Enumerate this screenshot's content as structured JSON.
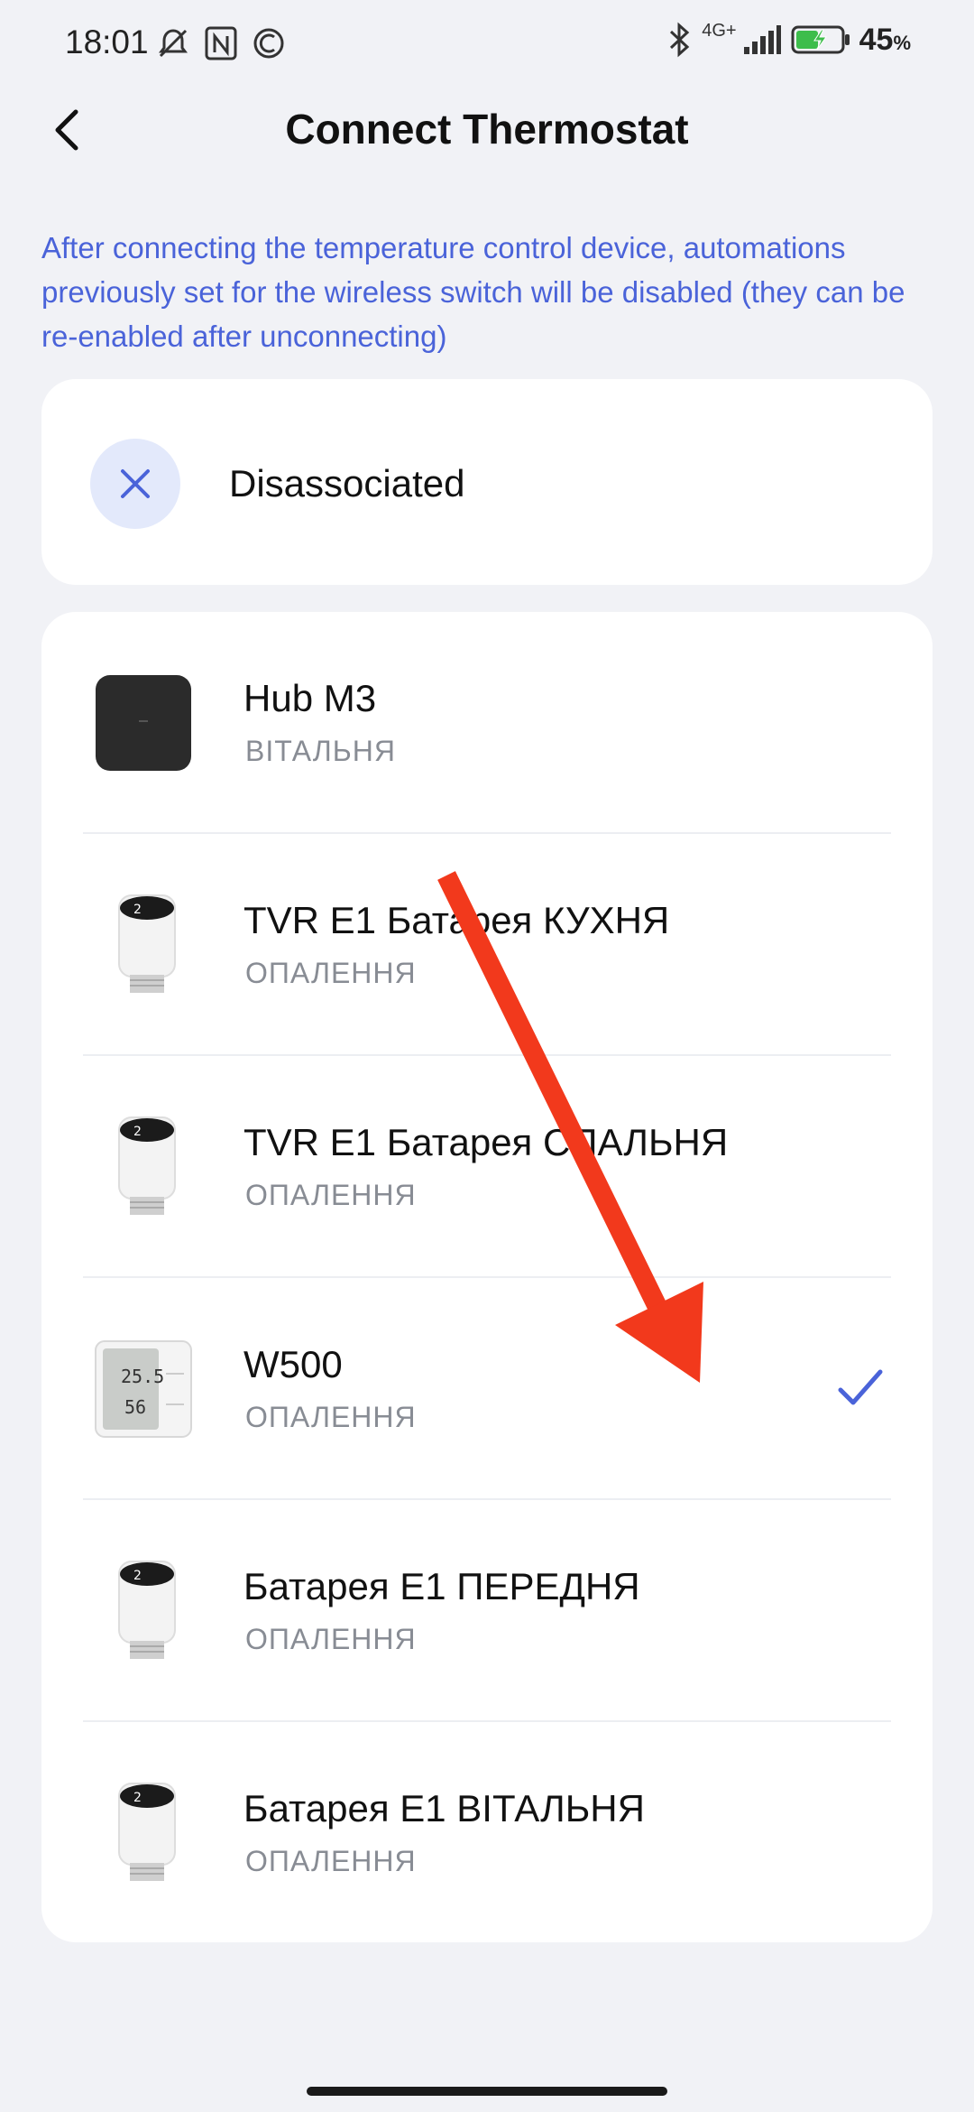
{
  "status_bar": {
    "time": "18:01",
    "network": "4G+",
    "battery": "45",
    "battery_unit": "%"
  },
  "header": {
    "title": "Connect Thermostat",
    "back_icon": "chevron-left-icon"
  },
  "notice": "After connecting the temperature control device, automations previously set for the wireless switch will be disabled (they can be re-enabled after unconnecting)",
  "disassociated": {
    "label": "Disassociated",
    "icon": "close-icon",
    "accent": "#4a63d9"
  },
  "devices": [
    {
      "name": "Hub M3",
      "room": "ВІТАЛЬНЯ",
      "icon": "hub-icon",
      "selected": false
    },
    {
      "name": "TVR E1 Батарея  КУХНЯ",
      "room": "ОПАЛЕННЯ",
      "icon": "radiator-valve-icon",
      "selected": false
    },
    {
      "name": "TVR E1 Батарея СПАЛЬНЯ",
      "room": "ОПАЛЕННЯ",
      "icon": "radiator-valve-icon",
      "selected": false
    },
    {
      "name": "W500",
      "room": "ОПАЛЕННЯ",
      "icon": "thermostat-panel-icon",
      "selected": true
    },
    {
      "name": "Батарея Е1 ПЕРЕДНЯ",
      "room": "ОПАЛЕННЯ",
      "icon": "radiator-valve-icon",
      "selected": false
    },
    {
      "name": "Батарея Е1 ВІТАЛЬНЯ",
      "room": "ОПАЛЕННЯ",
      "icon": "radiator-valve-icon",
      "selected": false
    }
  ],
  "w500_display": {
    "temp": "25.5",
    "humidity": "56"
  },
  "colors": {
    "background": "#f1f2f6",
    "accent": "#4a63d9",
    "annotation_arrow": "#f2391c"
  }
}
